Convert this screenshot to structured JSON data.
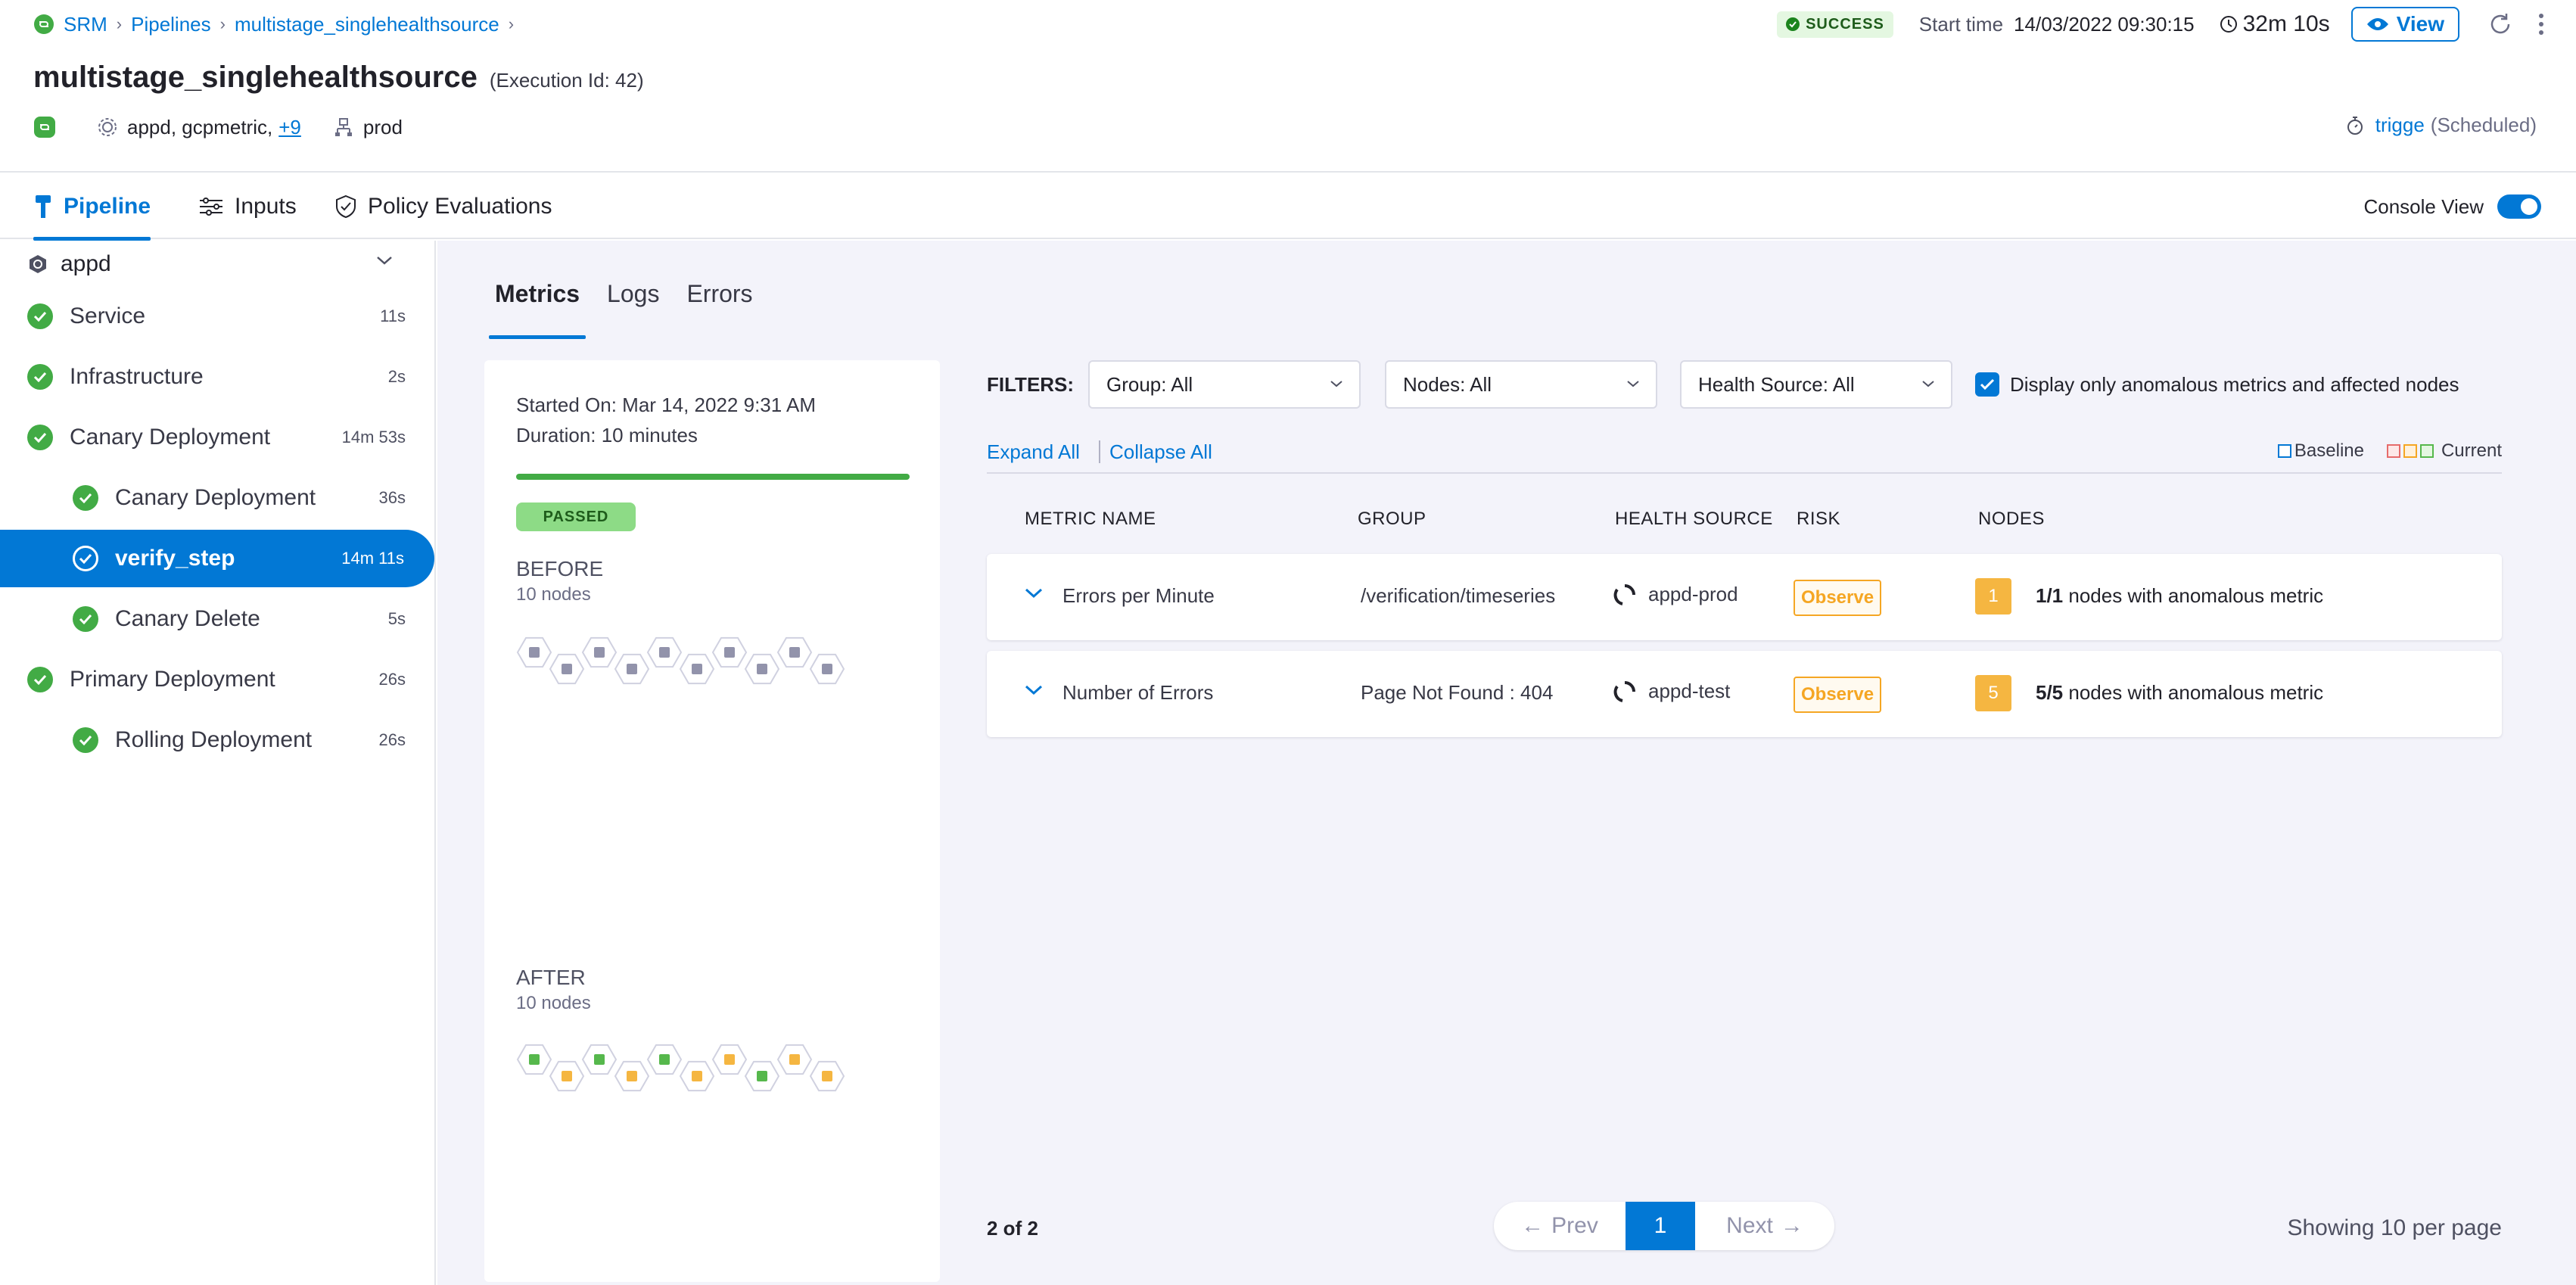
{
  "breadcrumb": {
    "items": [
      "SRM",
      "Pipelines",
      "multistage_singlehealthsource"
    ]
  },
  "pipeline": {
    "name": "multistage_singlehealthsource",
    "execution_id": "(Execution Id: 42)",
    "services": "appd, gcpmetric,",
    "services_more": "+9",
    "environment": "prod"
  },
  "status": {
    "badge": "SUCCESS",
    "start_label": "Start time",
    "start_value": "14/03/2022 09:30:15",
    "duration": "32m 10s",
    "view_label": "View",
    "trigger_user": "trigge",
    "trigger_type": "(Scheduled)"
  },
  "tabs": [
    {
      "label": "Pipeline",
      "active": true
    },
    {
      "label": "Inputs",
      "active": false
    },
    {
      "label": "Policy Evaluations",
      "active": false
    }
  ],
  "console_view_label": "Console View",
  "console_view_on": true,
  "stage": {
    "name": "appd"
  },
  "steps": [
    {
      "label": "Service",
      "duration": "11s",
      "indent": 0
    },
    {
      "label": "Infrastructure",
      "duration": "2s",
      "indent": 0
    },
    {
      "label": "Canary Deployment",
      "duration": "14m 53s",
      "indent": 0
    },
    {
      "label": "Canary Deployment",
      "duration": "36s",
      "indent": 1
    },
    {
      "label": "verify_step",
      "duration": "14m 11s",
      "indent": 1,
      "active": true
    },
    {
      "label": "Canary Delete",
      "duration": "5s",
      "indent": 1
    },
    {
      "label": "Primary Deployment",
      "duration": "26s",
      "indent": 0
    },
    {
      "label": "Rolling Deployment",
      "duration": "26s",
      "indent": 1
    }
  ],
  "subtabs": [
    {
      "label": "Metrics",
      "active": true
    },
    {
      "label": "Logs",
      "active": false
    },
    {
      "label": "Errors",
      "active": false
    }
  ],
  "summary": {
    "started_on": "Started On: Mar 14, 2022 9:31 AM",
    "duration": "Duration: 10 minutes",
    "progress": 1.0,
    "status": "PASSED",
    "before_label": "BEFORE",
    "before_nodes": "10 nodes",
    "after_label": "AFTER",
    "after_nodes": "10 nodes",
    "after_node_states": [
      "green",
      "orange",
      "green",
      "orange",
      "green",
      "orange",
      "orange",
      "green",
      "orange",
      "orange"
    ]
  },
  "filters": {
    "label": "FILTERS:",
    "group": "Group: All",
    "nodes": "Nodes: All",
    "health_source": "Health Source: All",
    "anomalous_only_label": "Display only anomalous metrics and affected nodes",
    "anomalous_only": true
  },
  "controls": {
    "expand_all": "Expand All",
    "collapse_all": "Collapse All",
    "legend_baseline": "Baseline",
    "legend_current": "Current"
  },
  "table": {
    "headers": [
      "METRIC NAME",
      "GROUP",
      "HEALTH SOURCE",
      "RISK",
      "NODES"
    ],
    "rows": [
      {
        "metric": "Errors per Minute",
        "group": "/verification/timeseries",
        "health_source": "appd-prod",
        "risk": "Observe",
        "node_count": "1",
        "nodes_ratio": "1/1",
        "nodes_text": "nodes with anomalous metric"
      },
      {
        "metric": "Number of Errors",
        "group": "Page Not Found : 404",
        "health_source": "appd-test",
        "risk": "Observe",
        "node_count": "5",
        "nodes_ratio": "5/5",
        "nodes_text": "nodes with anomalous metric"
      }
    ]
  },
  "pagination": {
    "count": "2 of 2",
    "prev": "Prev",
    "current": "1",
    "next": "Next",
    "per_page": "Showing 10 per page"
  },
  "colors": {
    "accent": "#0278d5",
    "success": "#42ab45",
    "warning": "#f5a623",
    "node_green": "#56b84c",
    "node_orange": "#f5b641",
    "node_grey": "#9293ab"
  }
}
